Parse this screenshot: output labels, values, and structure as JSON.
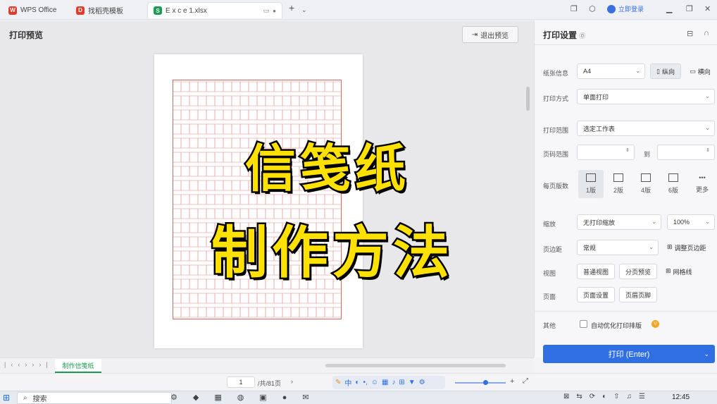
{
  "tabs": [
    {
      "label": "WPS Office",
      "color": "#e23b2e",
      "glyph": "W"
    },
    {
      "label": "找稻壳模板",
      "color": "#e23b2e",
      "glyph": "D"
    },
    {
      "label": "E x c e 1.xlsx",
      "color": "#1c9b54",
      "glyph": "S"
    }
  ],
  "header": {
    "login_label": "立即登录"
  },
  "preview": {
    "title": "打印预览",
    "exit_label": "退出预览"
  },
  "overlay": {
    "line1": "信笺纸",
    "line2": "制作方法"
  },
  "settings": {
    "title": "打印设置",
    "paper_label": "纸张信息",
    "paper_value": "A4",
    "portrait_label": "纵向",
    "landscape_label": "横向",
    "print_mode_label": "打印方式",
    "print_mode_value": "单面打印",
    "print_range_label": "打印范围",
    "print_range_value": "选定工作表",
    "page_range_label": "页码范围",
    "page_range_to": "到",
    "pages_per_sheet_label": "每页版数",
    "pages_per_sheet": [
      "1版",
      "2版",
      "4版",
      "6版",
      "更多"
    ],
    "scale_label": "缩放",
    "scale_value": "无打印缩放",
    "scale_percent": "100%",
    "margin_label": "页边距",
    "margin_value": "常规",
    "margin_adjust_label": "调整页边距",
    "view_label": "视图",
    "view_normal": "普通视图",
    "view_pagebreak": "分页预览",
    "gridlines_label": "网格线",
    "page_label": "页面",
    "page_setup": "页面设置",
    "header_footer": "页眉页脚",
    "other_label": "其他",
    "auto_optimize_label": "自动优化打印排版",
    "print_button": "打印 (Enter)"
  },
  "sheet": {
    "tab_name": "制作信笺纸"
  },
  "status": {
    "page_current": "1",
    "page_total": "/共/81页"
  },
  "taskbar": {
    "search_placeholder": "搜索",
    "time": "12:45"
  }
}
